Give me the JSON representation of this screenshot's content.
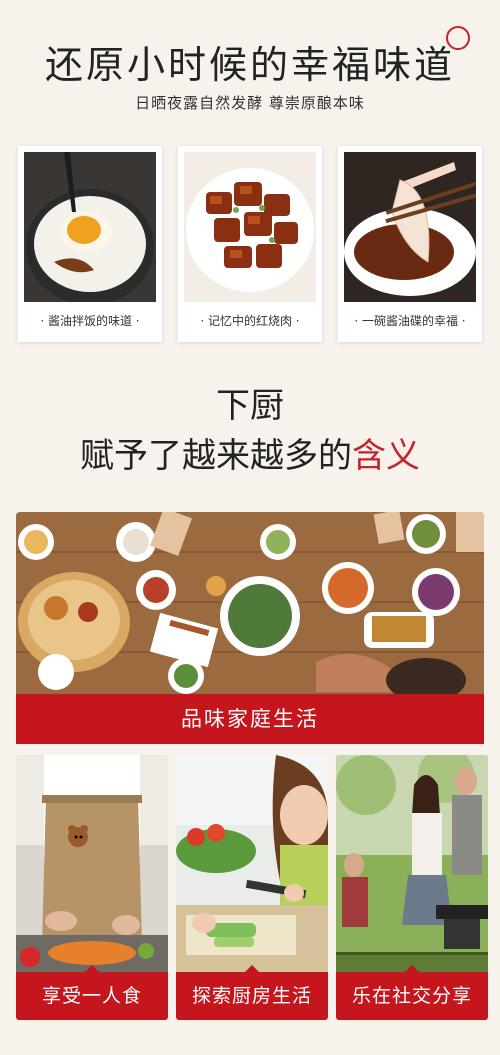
{
  "header": {
    "title": "还原小时候的幸福味道",
    "subtitle": "日晒夜露自然发酵 尊崇原酿本味"
  },
  "memories": [
    {
      "caption": "· 酱油拌饭的味道 ·",
      "image": "rice-with-egg-and-soy-sauce"
    },
    {
      "caption": "· 记忆中的红烧肉 ·",
      "image": "braised-pork"
    },
    {
      "caption": "· 一碗酱油碟的幸福 ·",
      "image": "sliced-meat-dipped-in-soy-sauce"
    }
  ],
  "section": {
    "line1": "下厨",
    "line2_prefix": "赋予了越来越多的",
    "line2_highlight": "含义"
  },
  "family": {
    "image": "family-dinner-table",
    "banner": "品味家庭生活"
  },
  "tiles": [
    {
      "label": "享受一人食",
      "image": "cooking-alone-apron"
    },
    {
      "label": "探索厨房生活",
      "image": "child-cutting-vegetables"
    },
    {
      "label": "乐在社交分享",
      "image": "outdoor-barbecue-friends"
    }
  ],
  "colors": {
    "accent": "#c4161c",
    "background": "#f7f2ec"
  }
}
